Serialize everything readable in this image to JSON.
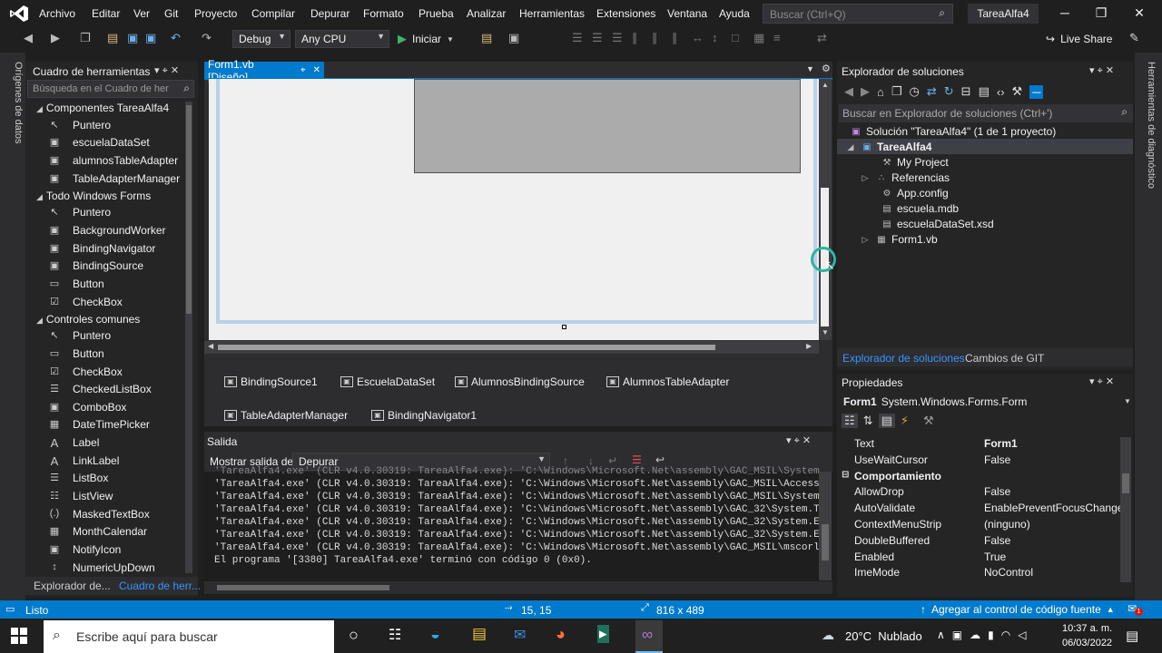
{
  "menubar": {
    "items": [
      "Archivo",
      "Editar",
      "Ver",
      "Git",
      "Proyecto",
      "Compilar",
      "Depurar",
      "Formato",
      "Prueba",
      "Analizar",
      "Herramientas",
      "Extensiones",
      "Ventana",
      "Ayuda"
    ],
    "search_placeholder": "Buscar (Ctrl+Q)",
    "project_name": "TareaAlfa4"
  },
  "toolbar": {
    "config": "Debug",
    "platform": "Any CPU",
    "start_label": "Iniciar",
    "live_share": "Live Share"
  },
  "side_strips": {
    "left": "Orígenes de datos",
    "right": "Herramientas de diagnóstico"
  },
  "toolbox": {
    "title": "Cuadro de herramientas",
    "search_placeholder": "Búsqueda en el Cuadro de her",
    "groups": [
      {
        "label": "Componentes TareaAlfa4",
        "items": [
          "Puntero",
          "escuelaDataSet",
          "alumnosTableAdapter",
          "TableAdapterManager"
        ]
      },
      {
        "label": "Todo Windows Forms",
        "items": [
          "Puntero",
          "BackgroundWorker",
          "BindingNavigator",
          "BindingSource",
          "Button",
          "CheckBox"
        ]
      },
      {
        "label": "Controles comunes",
        "items": [
          "Puntero",
          "Button",
          "CheckBox",
          "CheckedListBox",
          "ComboBox",
          "DateTimePicker",
          "Label",
          "LinkLabel",
          "ListBox",
          "ListView",
          "MaskedTextBox",
          "MonthCalendar",
          "NotifyIcon",
          "NumericUpDown"
        ]
      }
    ],
    "bottom_tabs": [
      "Explorador de...",
      "Cuadro de herr..."
    ]
  },
  "document": {
    "tab_label": "Form1.vb [Diseño]",
    "tray_components": [
      "BindingSource1",
      "EscuelaDataSet",
      "AlumnosBindingSource",
      "AlumnosTableAdapter",
      "TableAdapterManager",
      "BindingNavigator1"
    ]
  },
  "output": {
    "title": "Salida",
    "show_from_label": "Mostrar salida de:",
    "source": "Depurar",
    "lines": [
      "'TareaAlfa4.exe' (CLR v4.0.30319: TareaAlfa4.exe): 'C:\\Windows\\Microsoft.Net\\assembly\\GAC_MSIL\\System",
      "'TareaAlfa4.exe' (CLR v4.0.30319: TareaAlfa4.exe): 'C:\\Windows\\Microsoft.Net\\assembly\\GAC_MSIL\\Access",
      "'TareaAlfa4.exe' (CLR v4.0.30319: TareaAlfa4.exe): 'C:\\Windows\\Microsoft.Net\\assembly\\GAC_MSIL\\System",
      "'TareaAlfa4.exe' (CLR v4.0.30319: TareaAlfa4.exe): 'C:\\Windows\\Microsoft.Net\\assembly\\GAC_32\\System.T",
      "'TareaAlfa4.exe' (CLR v4.0.30319: TareaAlfa4.exe): 'C:\\Windows\\Microsoft.Net\\assembly\\GAC_32\\System.E",
      "'TareaAlfa4.exe' (CLR v4.0.30319: TareaAlfa4.exe): 'C:\\Windows\\Microsoft.Net\\assembly\\GAC_32\\System.E",
      "'TareaAlfa4.exe' (CLR v4.0.30319: TareaAlfa4.exe): 'C:\\Windows\\Microsoft.Net\\assembly\\GAC_MSIL\\mscorl",
      "El programa '[3380] TareaAlfa4.exe' terminó con código 0 (0x0)."
    ]
  },
  "solution_explorer": {
    "title": "Explorador de soluciones",
    "search_placeholder": "Buscar en Explorador de soluciones (Ctrl+')",
    "solution": "Solución \"TareaAlfa4\" (1 de 1 proyecto)",
    "project": "TareaAlfa4",
    "items": [
      "My Project",
      "Referencias",
      "App.config",
      "escuela.mdb",
      "escuelaDataSet.xsd",
      "Form1.vb"
    ],
    "tabs": [
      "Explorador de soluciones",
      "Cambios de GIT"
    ]
  },
  "properties": {
    "title": "Propiedades",
    "object": "Form1",
    "object_type": "System.Windows.Forms.Form",
    "rows": [
      {
        "k": "Text",
        "v": "Form1"
      },
      {
        "k": "UseWaitCursor",
        "v": "False"
      }
    ],
    "category": "Comportamiento",
    "rows2": [
      {
        "k": "AllowDrop",
        "v": "False"
      },
      {
        "k": "AutoValidate",
        "v": "EnablePreventFocusChange"
      },
      {
        "k": "ContextMenuStrip",
        "v": "(ninguno)"
      },
      {
        "k": "DoubleBuffered",
        "v": "False"
      },
      {
        "k": "Enabled",
        "v": "True"
      },
      {
        "k": "ImeMode",
        "v": "NoControl"
      }
    ]
  },
  "statusbar": {
    "ready": "Listo",
    "position": "15, 15",
    "size": "816 x 489",
    "source_control": "Agregar al control de código fuente"
  },
  "taskbar": {
    "search_placeholder": "Escribe aquí para buscar",
    "weather": "20°C  Nublado",
    "time": "10:37 a. m.",
    "date": "06/03/2022"
  },
  "colors": {
    "accent": "#007acc",
    "vs_purple": "#68217a"
  }
}
